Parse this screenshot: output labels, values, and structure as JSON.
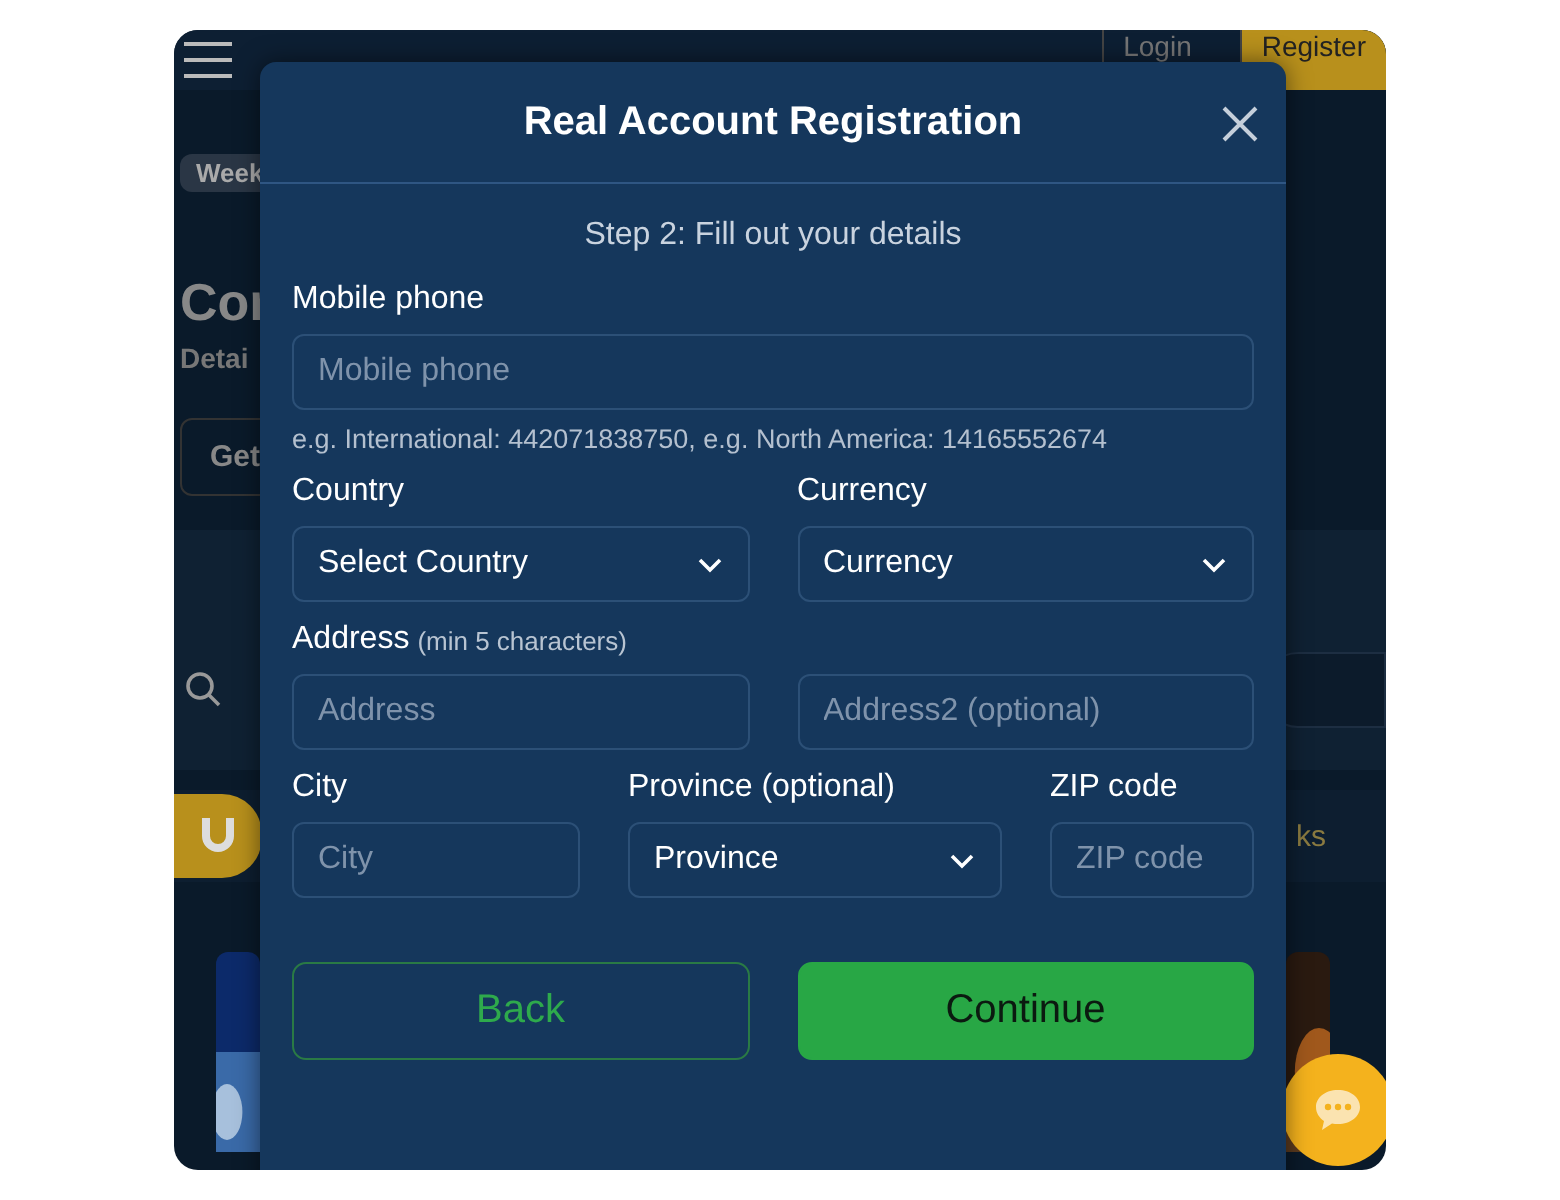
{
  "background": {
    "login": "Login",
    "register": "Register",
    "chip": "Week",
    "heading": "Cor",
    "subheading": "Detai",
    "button": "Get",
    "tab_text": "ks"
  },
  "modal": {
    "title": "Real Account Registration",
    "step": "Step 2: Fill out your details",
    "rows": [
      [
        {
          "kind": "input",
          "label": "Mobile phone",
          "placeholder": "Mobile phone",
          "hint": "e.g. International: 442071838750, e.g. North America: 14165552674"
        }
      ],
      [
        {
          "kind": "select",
          "label": "Country",
          "value": "Select Country"
        },
        {
          "kind": "select",
          "label": "Currency",
          "value": "Currency"
        }
      ],
      [
        {
          "kind": "input",
          "label": "Address",
          "note": "(min 5 characters)",
          "placeholder": "Address"
        },
        {
          "kind": "input",
          "placeholder": "Address2 (optional)"
        }
      ],
      [
        {
          "kind": "input",
          "label": "City",
          "placeholder": "City"
        },
        {
          "kind": "select",
          "label": "Province (optional)",
          "value": "Province"
        },
        {
          "kind": "input",
          "label": "ZIP code",
          "placeholder": "ZIP code"
        }
      ]
    ],
    "buttons": [
      {
        "kind": "outline",
        "label": "Back"
      },
      {
        "kind": "primary",
        "label": "Continue"
      }
    ]
  }
}
